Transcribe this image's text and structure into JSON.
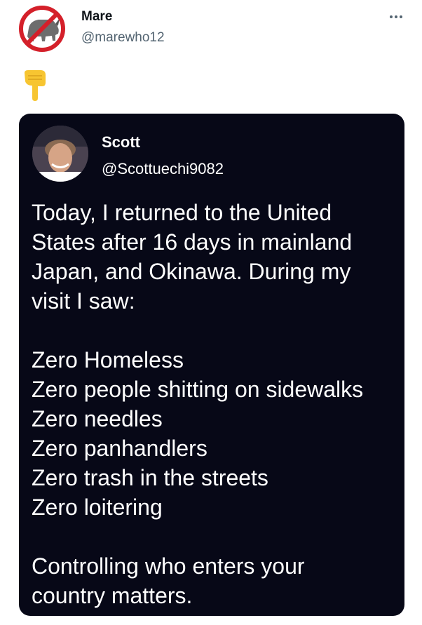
{
  "author": {
    "name": "Mare",
    "handle": "@marewho12",
    "avatar_icon": "crossed-out-rhino-icon"
  },
  "menu_icon": "more-horizontal-icon",
  "emoji": "pointing-down-emoji",
  "quoted": {
    "name": "Scott",
    "handle": "@Scottuechi9082",
    "avatar_icon": "profile-photo",
    "lines": [
      "Today, I returned to the United",
      "States after 16 days in mainland",
      "Japan, and Okinawa. During my",
      "visit I saw:",
      "",
      "Zero Homeless",
      "Zero people shitting on sidewalks",
      "Zero needles",
      "Zero panhandlers",
      "Zero trash in the streets",
      "Zero loitering",
      "",
      "Controlling who enters your",
      "country matters."
    ]
  },
  "colors": {
    "name": "#0f1419",
    "handle": "#536471",
    "card_bg": "#070817",
    "card_text": "#ffffff",
    "prohibition_red": "#d4202a",
    "emoji_yellow": "#f7c531"
  }
}
